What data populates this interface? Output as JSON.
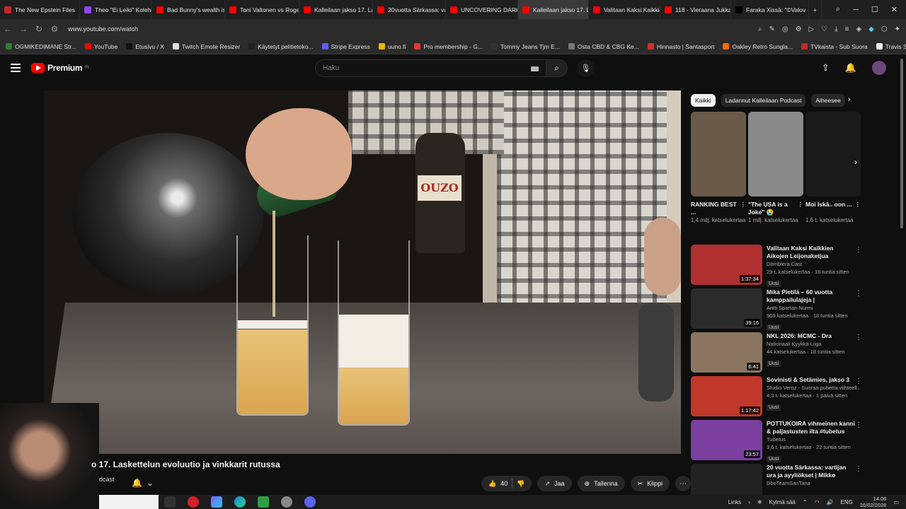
{
  "browser": {
    "tabs": [
      {
        "label": "The New Epstein Files",
        "color": "#c62828"
      },
      {
        "label": "Theo \"Ei Leiki\" Kolehm",
        "color": "#9146ff"
      },
      {
        "label": "Bad Bunny's wealth is",
        "color": "#ff0000"
      },
      {
        "label": "Toni Valtonen vs Roge",
        "color": "#ff0000"
      },
      {
        "label": "Kalleilaan jakso 17. La",
        "color": "#ff0000"
      },
      {
        "label": "20vuotta Särkassa: va",
        "color": "#ff0000"
      },
      {
        "label": "UNCOVERING DARK E",
        "color": "#ff0000"
      },
      {
        "label": "Kalleilaan jakso 17. La",
        "color": "#ff0000"
      },
      {
        "label": "Valitaan Kaksi Kaikkien",
        "color": "#ff0000"
      },
      {
        "label": "118 - Vieraana Jukka P",
        "color": "#ff0000"
      },
      {
        "label": "Faraka Xissä: \"©Valov",
        "color": "#000000"
      }
    ],
    "active_tab_index": 7,
    "url": "www.youtube.com/watch",
    "bookmarks": [
      {
        "label": "OGMIKEDIMANE Str...",
        "color": "#2e7d32"
      },
      {
        "label": "YouTube",
        "color": "#ff0000"
      },
      {
        "label": "Etusivu / X",
        "color": "#111111"
      },
      {
        "label": "Twitch Emote Resizer",
        "color": "#dddddd"
      },
      {
        "label": "Käytetyt pelitietoko...",
        "color": "#222222"
      },
      {
        "label": "Stripe Express",
        "color": "#635bff"
      },
      {
        "label": "uuno.fi",
        "color": "#e6b800"
      },
      {
        "label": "Pro membership - G...",
        "color": "#e53935"
      },
      {
        "label": "Tommy Jeans Tjm E...",
        "color": "#333333"
      },
      {
        "label": "Osta CBD & CBG Ke...",
        "color": "#777777"
      },
      {
        "label": "Hinnasto | Santasport",
        "color": "#d32f2f"
      },
      {
        "label": "Oakley Retro Sungla...",
        "color": "#ef6c00"
      },
      {
        "label": "TVkaista - Sub Suora",
        "color": "#c62828"
      },
      {
        "label": "Travis Scott: Outfits,...",
        "color": "#eeeeee"
      }
    ]
  },
  "youtube": {
    "logo_text": "Premium",
    "logo_sup": "FI",
    "search_placeholder": "Haku",
    "video_label": "OUZO",
    "video_title": "o 17. Laskettelun evoluutio ja vinkkarit rutussa",
    "channel_partial": "dcast",
    "actions": {
      "likes": "40",
      "share": "Jaa",
      "save": "Tallenna",
      "clip": "Klippi"
    },
    "chips": [
      "Kaikki",
      "Ladannut Kalleilaan Podcast",
      "Aiheesee"
    ],
    "shorts": [
      {
        "title": "RANKING BEST ...",
        "views": "1,4 milj. katselukertaa",
        "thumb_color": "#6b5a4a"
      },
      {
        "title": "\"The USA is a Joke\" 😭",
        "views": "1 milj. katselukertaa",
        "thumb_color": "#8a8a8a"
      },
      {
        "title": "Moi Iskä.. oon ...",
        "views": "1,6 t. katselukertaa",
        "thumb_color": "#1a1a1a"
      }
    ],
    "recommendations": [
      {
        "title": "Valitaan Kaksi Kaikkien Aikojen Leijonaketjua",
        "channel": "Dämblera Cast",
        "meta": "29 t. katselukertaa · 18 tuntia sitten",
        "badge": "Uusi",
        "duration": "1:37:34",
        "thumb_color": "#b03030"
      },
      {
        "title": "Mika Pietilä – 60 vuotta kamppailulajeja | Tainyrkkeily...",
        "channel": "Antti Spartan Nurmi",
        "meta": "969 katselukertaa · 18 tuntia sitten",
        "badge": "Uusi",
        "duration": "39:16",
        "thumb_color": "#2b2b2b"
      },
      {
        "title": "NKL 2026: MCMC - Dra",
        "channel": "Nationaali Kyykkä Liiga",
        "meta": "44 katselukertaa · 18 tuntia sitten",
        "badge": "Uusi",
        "duration": "6:41",
        "thumb_color": "#8a7660"
      },
      {
        "title": "Sovinisti & Setämies, jakso 3",
        "channel": "Studio Veroz - Suoraa puhetta viihteell...",
        "meta": "4,3 t. katselukertaa · 1 päivä sitten",
        "badge": "Uusi",
        "duration": "1:17:42",
        "thumb_color": "#c0392b"
      },
      {
        "title": "POTTUKOIRA vihmeinen kanni & paljastusten ilta #tubetus",
        "channel": "Tubetus",
        "meta": "3,6 t. katselukertaa · 22 tuntia sitten",
        "badge": "Uusi",
        "duration": "23:57",
        "thumb_color": "#7b3fa0"
      },
      {
        "title": "20 vuotta Särkassa: vartijan ura ja ayyliökset | Mikko Kliskilä",
        "channel": "DboTeamSanTana",
        "meta": "",
        "badge": "",
        "duration": "",
        "thumb_color": "#222222"
      }
    ]
  },
  "taskbar": {
    "links": "Links",
    "weather": "Kylmä sää",
    "lang": "ENG",
    "time": "14.06",
    "date": "16/02/2026"
  }
}
